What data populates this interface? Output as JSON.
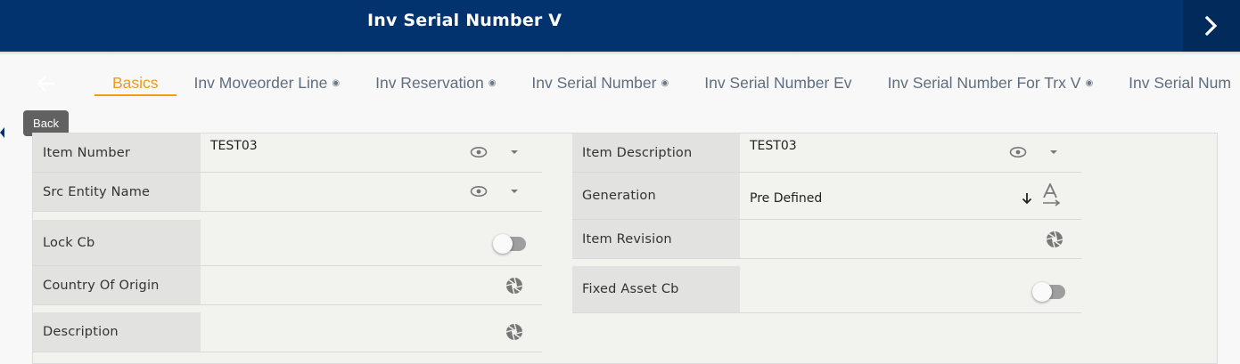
{
  "header": {
    "title": "Inv Serial Number V"
  },
  "nav": {
    "back_tooltip": "Back"
  },
  "tabs": [
    {
      "label": "Basics",
      "active": true
    },
    {
      "label": "Inv Moveorder Line",
      "has_icon": true
    },
    {
      "label": "Inv Reservation",
      "has_icon": true
    },
    {
      "label": "Inv Serial Number",
      "has_icon": true
    },
    {
      "label": "Inv Serial Number Ev",
      "has_icon": false
    },
    {
      "label": "Inv Serial Number For Trx V",
      "has_icon": true
    },
    {
      "label": "Inv Serial Num",
      "has_icon": false
    }
  ],
  "left_fields": {
    "item_number": {
      "label": "Item Number",
      "value": "TEST03"
    },
    "src_entity_name": {
      "label": "Src Entity Name",
      "value": ""
    },
    "lock_cb": {
      "label": "Lock Cb",
      "checked": false
    },
    "country_of_origin": {
      "label": "Country Of Origin",
      "value": ""
    },
    "description": {
      "label": "Description",
      "value": ""
    }
  },
  "right_fields": {
    "item_description": {
      "label": "Item Description",
      "value": "TEST03"
    },
    "generation": {
      "label": "Generation",
      "value": "Pre Defined"
    },
    "item_revision": {
      "label": "Item Revision",
      "value": ""
    },
    "fixed_asset_cb": {
      "label": "Fixed Asset Cb",
      "checked": false
    }
  },
  "colors": {
    "header_bg": "#02336e",
    "accent": "#f29a1a",
    "label_bg": "#e2e2e0",
    "form_bg": "#f2f3ef"
  },
  "icons": [
    "chevron-right-icon",
    "back-arrow-icon",
    "eye-icon",
    "caret-down-icon",
    "aperture-icon",
    "sort-down-icon",
    "text-format-icon"
  ]
}
